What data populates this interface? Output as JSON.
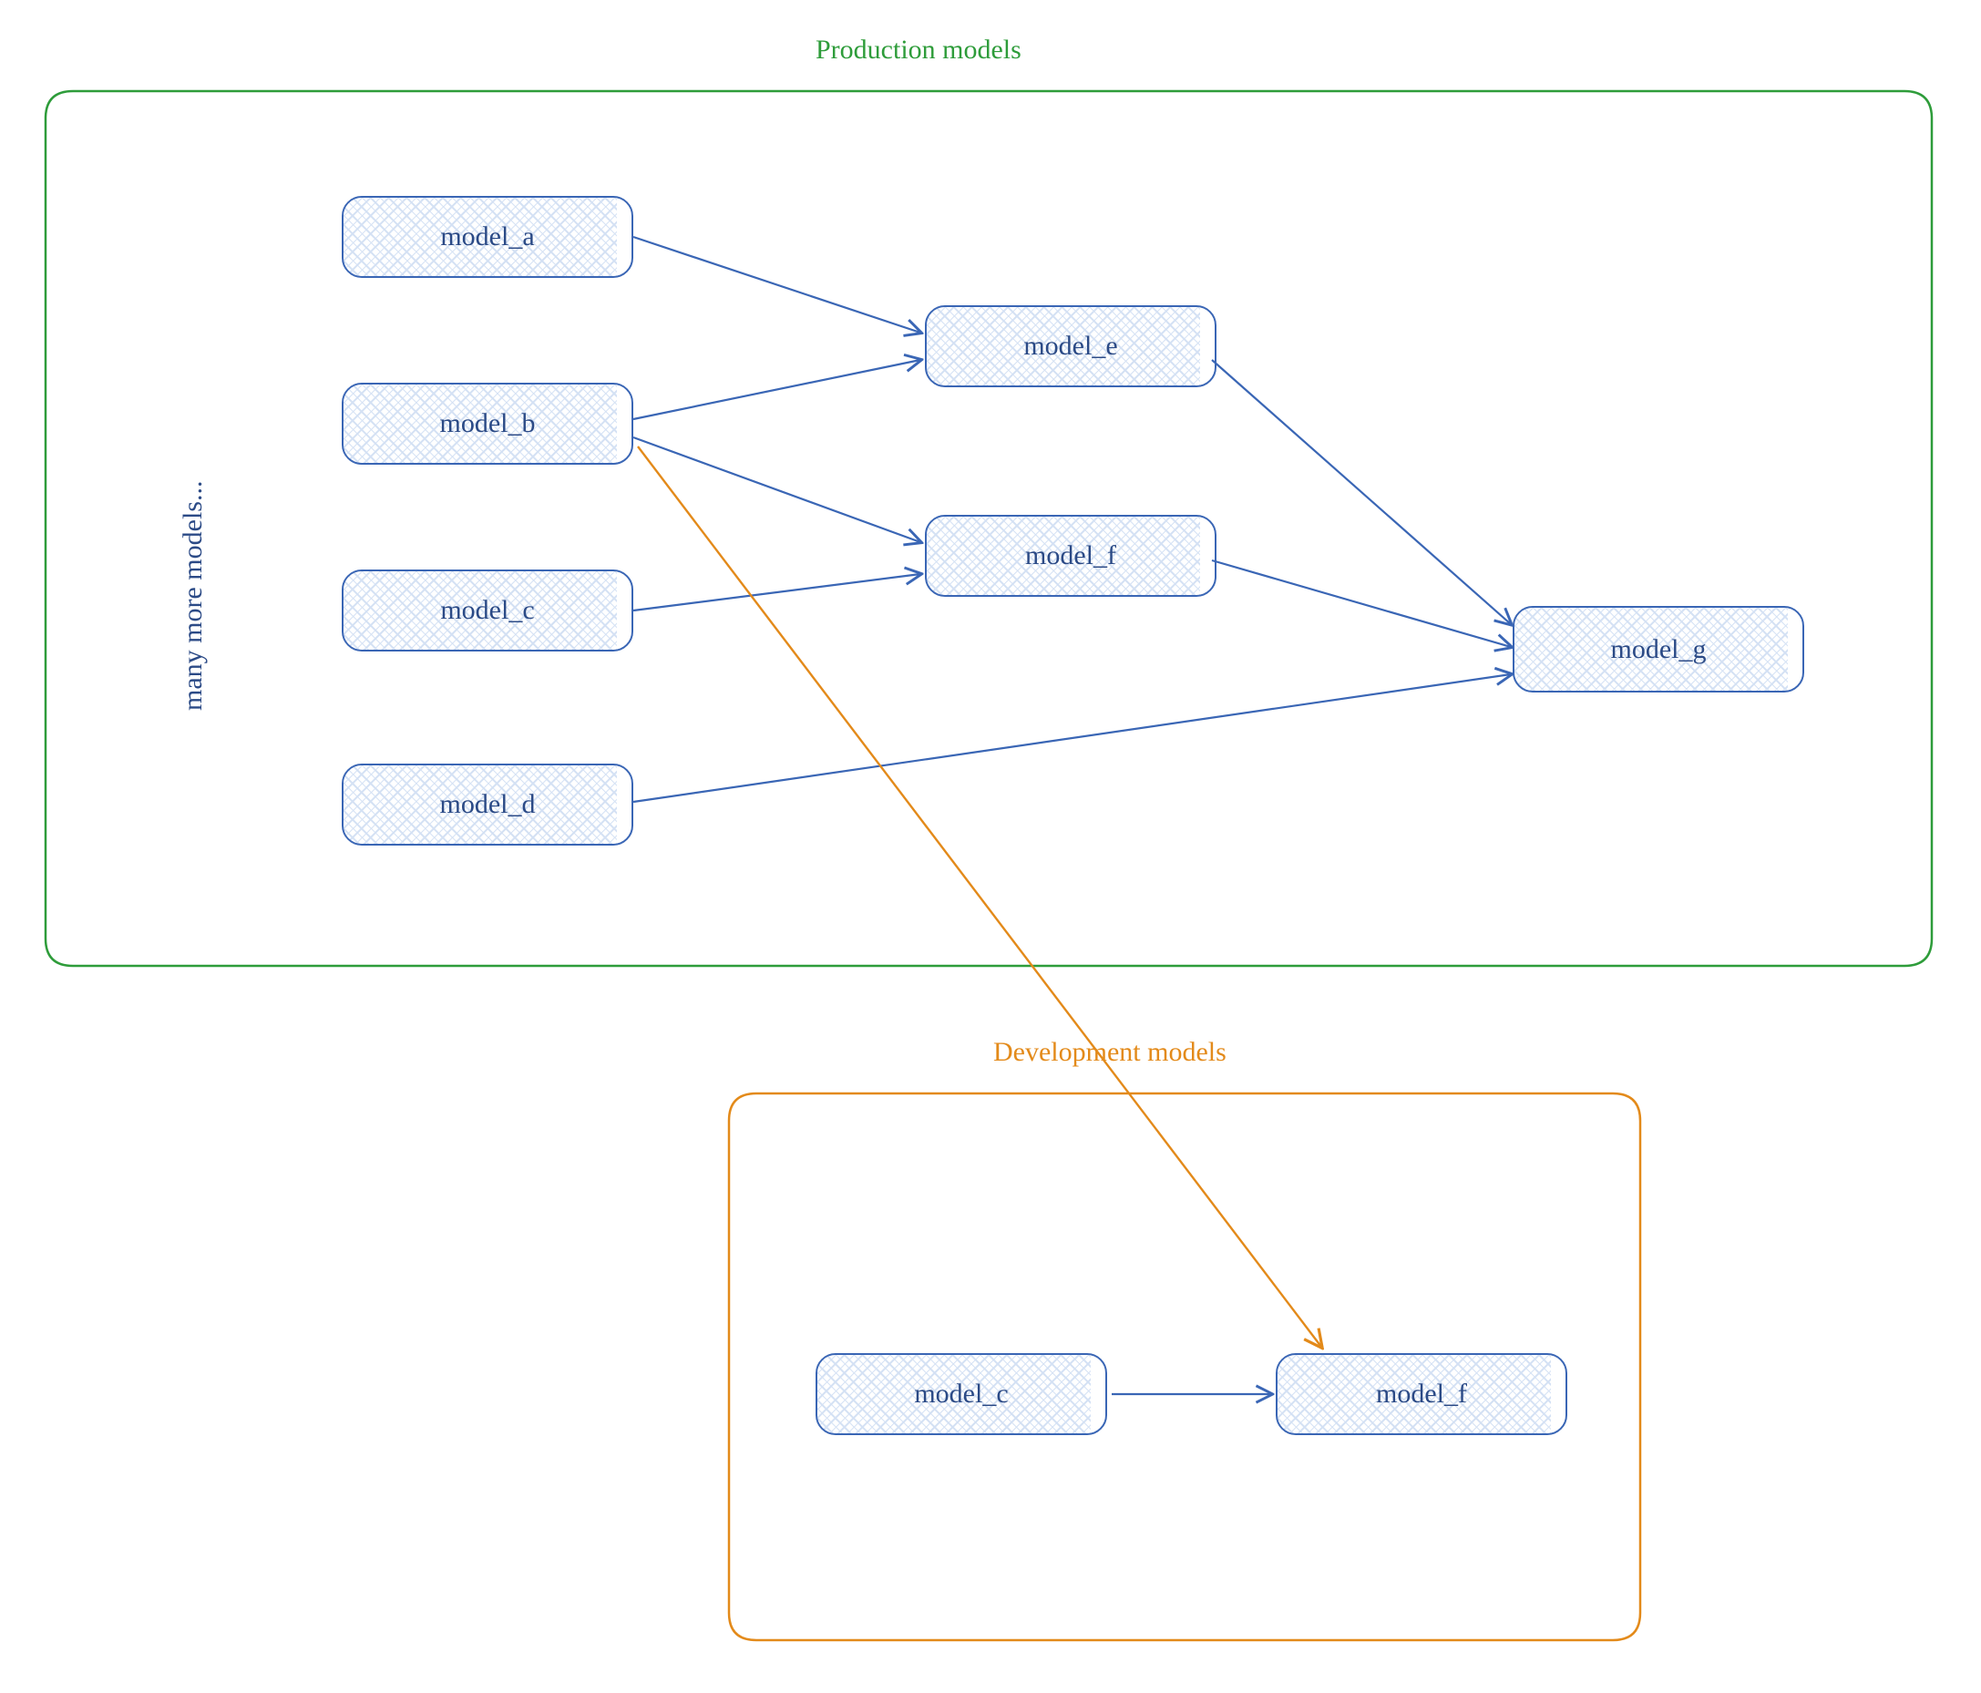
{
  "colors": {
    "production_border": "#2e9c3a",
    "development_border": "#e38a1a",
    "node_border": "#3a66b5",
    "node_text": "#2b4a86",
    "arrow_blue": "#3a66b5",
    "arrow_orange": "#e38a1a"
  },
  "groups": {
    "production": {
      "title": "Production models"
    },
    "development": {
      "title": "Development models"
    }
  },
  "side_label": "many more models...",
  "nodes": {
    "prod": {
      "model_a": "model_a",
      "model_b": "model_b",
      "model_c": "model_c",
      "model_d": "model_d",
      "model_e": "model_e",
      "model_f": "model_f",
      "model_g": "model_g"
    },
    "dev": {
      "model_c": "model_c",
      "model_f": "model_f"
    }
  },
  "edges_production": [
    {
      "from": "model_a",
      "to": "model_e"
    },
    {
      "from": "model_b",
      "to": "model_e"
    },
    {
      "from": "model_b",
      "to": "model_f"
    },
    {
      "from": "model_c",
      "to": "model_f"
    },
    {
      "from": "model_e",
      "to": "model_g"
    },
    {
      "from": "model_f",
      "to": "model_g"
    },
    {
      "from": "model_d",
      "to": "model_g"
    }
  ],
  "edges_development": [
    {
      "from": "model_c",
      "to": "model_f"
    }
  ],
  "cross_edges": [
    {
      "from": "production.model_b",
      "to": "development.model_f",
      "color": "orange"
    }
  ]
}
